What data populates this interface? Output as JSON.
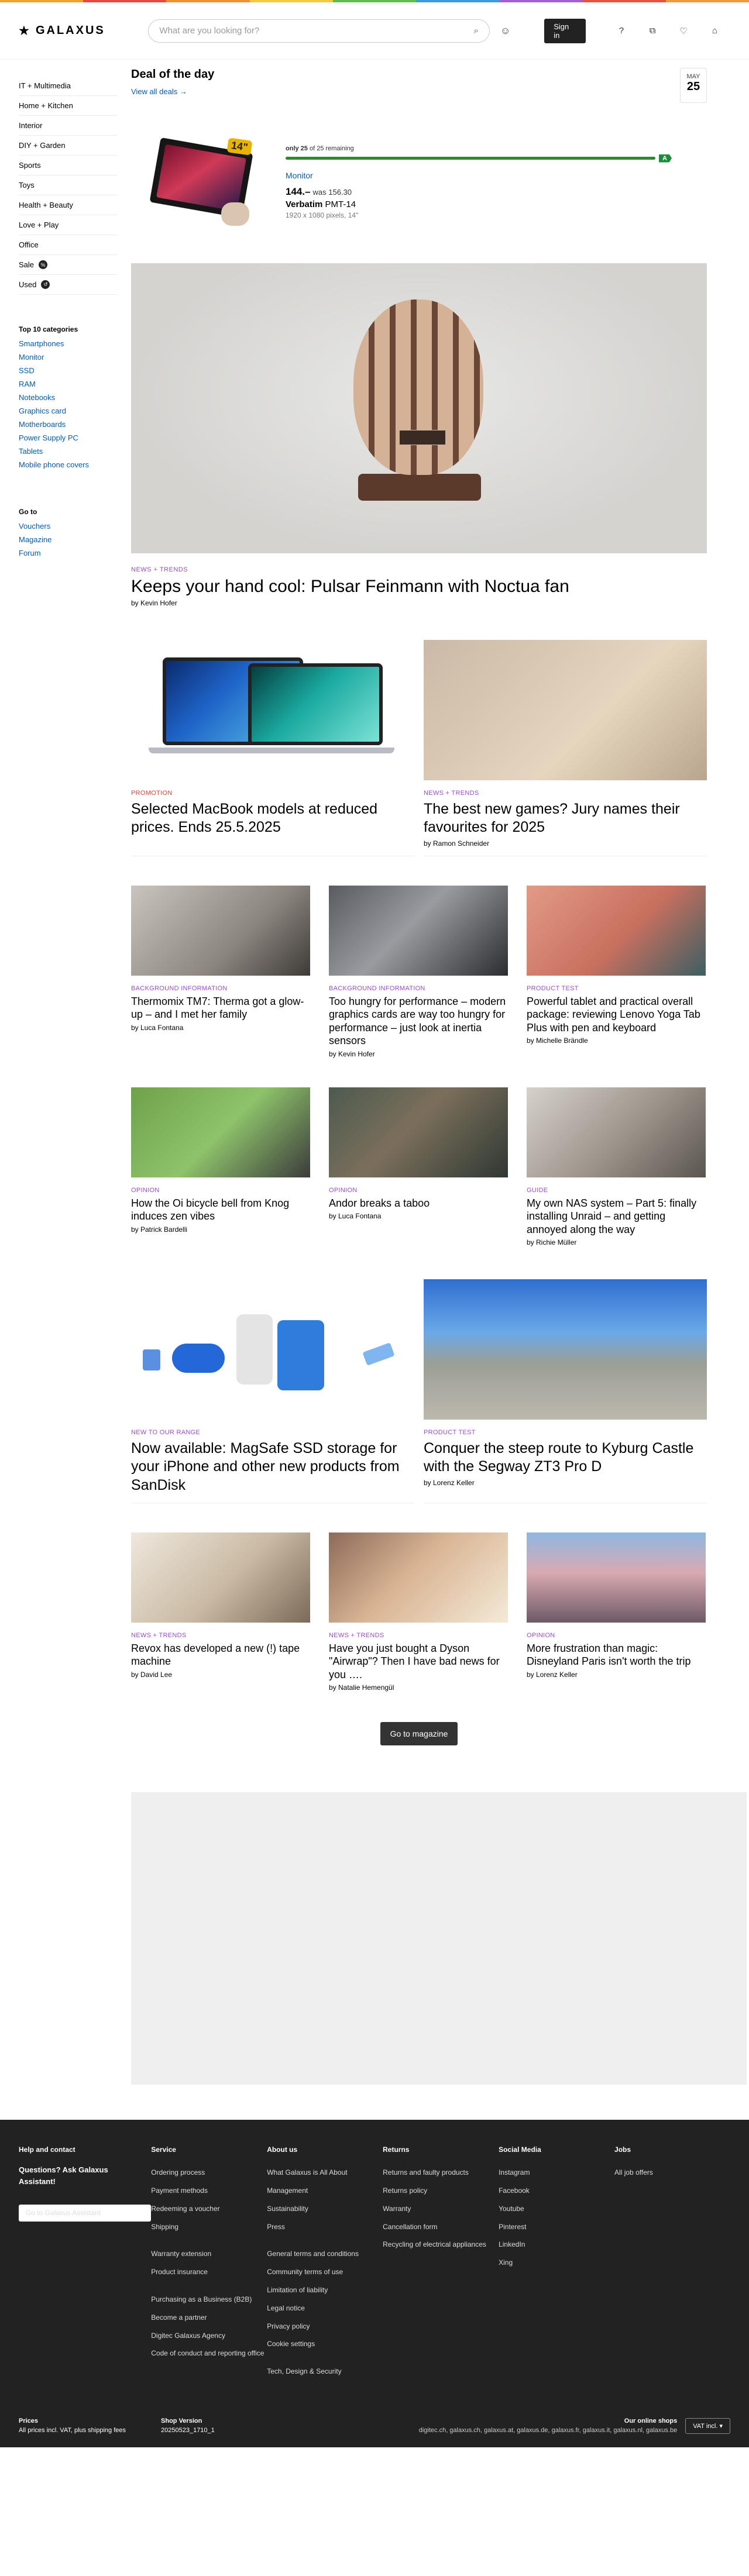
{
  "brand": {
    "name": "GALAXUS",
    "colors": [
      "#f4a32a",
      "#e9483e",
      "#f0902e",
      "#f6c83c",
      "#5cbf4d",
      "#3b9be0",
      "#a55fd6",
      "#e8513d",
      "#f19a3b"
    ]
  },
  "search": {
    "placeholder": "What are you looking for?"
  },
  "header": {
    "signin": "Sign in",
    "icons": [
      "person-circle-icon",
      "compare-icon",
      "heart-icon",
      "cart-icon"
    ]
  },
  "sidebar": {
    "items": [
      {
        "label": "IT + Multimedia"
      },
      {
        "label": "Home + Kitchen"
      },
      {
        "label": "Interior"
      },
      {
        "label": "DIY + Garden"
      },
      {
        "label": "Sports"
      },
      {
        "label": "Toys"
      },
      {
        "label": "Health + Beauty"
      },
      {
        "label": "Love + Play"
      },
      {
        "label": "Office"
      },
      {
        "label": "Sale",
        "badge": "%"
      },
      {
        "label": "Used",
        "badge": "↺"
      }
    ],
    "top_heading": "Top 10 categories",
    "top": [
      "Smartphones",
      "Monitor",
      "SSD",
      "RAM",
      "Notebooks",
      "Graphics card",
      "Motherboards",
      "Power Supply PC",
      "Tablets",
      "Mobile phone covers"
    ],
    "goto_heading": "Go to",
    "goto": [
      "Vouchers",
      "Magazine",
      "Forum"
    ]
  },
  "deal": {
    "title": "Deal of the day",
    "view_all": "View all deals",
    "month": "MAY",
    "day": "25",
    "remaining_count": "only 25",
    "remaining_rest": "of 25 remaining",
    "progress": 1.0,
    "energy": "A",
    "category": "Monitor",
    "price": "144.–",
    "was": "was 156.30",
    "brand": "Verbatim",
    "model": "PMT-14",
    "spec": "1920 x 1080 pixels, 14\"",
    "monitor_tag": "14\""
  },
  "hero": {
    "category": "News + Trends",
    "title": "Keeps your hand cool: Pulsar Feinmann with Noctua fan",
    "author": "by Kevin Hofer"
  },
  "row2a": [
    {
      "category": "Promotion",
      "title": "Selected MacBook models at reduced prices. Ends 25.5.2025",
      "author": ""
    },
    {
      "category": "News + Trends",
      "title": "The best new games? Jury names their favourites for 2025",
      "author": "by Ramon Schneider"
    }
  ],
  "row3a": [
    {
      "category": "Background information",
      "title": "Thermomix TM7: Therma got a glow-up – and I met her family",
      "author": "by Luca Fontana"
    },
    {
      "category": "Background information",
      "title": "Too hungry for performance – modern graphics cards are way too hungry for performance – just look at inertia sensors",
      "author": "by Kevin Hofer"
    },
    {
      "category": "Product test",
      "title": "Powerful tablet and practical overall package: reviewing Lenovo Yoga Tab Plus with pen and keyboard",
      "author": "by Michelle Brändle"
    }
  ],
  "row3b": [
    {
      "category": "Opinion",
      "title": "How the Oi bicycle bell from Knog induces zen vibes",
      "author": "by Patrick Bardelli"
    },
    {
      "category": "Opinion",
      "title": "Andor breaks a taboo",
      "author": "by Luca Fontana"
    },
    {
      "category": "Guide",
      "title": "My own NAS system – Part 5: finally installing Unraid – and getting annoyed along the way",
      "author": "by Richie Müller"
    }
  ],
  "row2b": [
    {
      "category": "New to our range",
      "title": "Now available: MagSafe SSD storage for your iPhone and other new products from SanDisk",
      "author": ""
    },
    {
      "category": "Product test",
      "title": "Conquer the steep route to Kyburg Castle with the Segway ZT3 Pro D",
      "author": "by Lorenz Keller"
    }
  ],
  "row3c": [
    {
      "category": "News + Trends",
      "title": "Revox has developed a new (!) tape machine",
      "author": "by David Lee"
    },
    {
      "category": "News + Trends",
      "title": "Have you just bought a Dyson \"Airwrap\"? Then I have bad news for you ….",
      "author": "by Natalie Hemengül"
    },
    {
      "category": "Opinion",
      "title": "More frustration than magic: Disneyland Paris isn't worth the trip",
      "author": "by Lorenz Keller"
    }
  ],
  "goto_magazine": "Go to magazine",
  "footer": {
    "help": {
      "heading": "Help and contact",
      "text": "Questions? Ask Galaxus Assistant!",
      "button": "Go to Galaxus Assistant"
    },
    "service": {
      "heading": "Service",
      "a": [
        "Ordering process",
        "Payment methods",
        "Redeeming a voucher",
        "Shipping"
      ],
      "b": [
        "Warranty extension",
        "Product insurance"
      ],
      "c": [
        "Purchasing as a Business (B2B)",
        "Become a partner",
        "Digitec Galaxus Agency",
        "Code of conduct and reporting office"
      ]
    },
    "about": {
      "heading": "About us",
      "a": [
        "What Galaxus is All About",
        "Management",
        "Sustainability",
        "Press"
      ],
      "b": [
        "General terms and conditions",
        "Community terms of use",
        "Limitation of liability",
        "Legal notice",
        "Privacy policy",
        "Cookie settings"
      ],
      "c": [
        "Tech, Design & Security"
      ]
    },
    "returns": {
      "heading": "Returns",
      "a": [
        "Returns and faulty products",
        "Returns policy",
        "Warranty",
        "Cancellation form",
        "Recycling of electrical appliances"
      ]
    },
    "social": {
      "heading": "Social Media",
      "a": [
        "Instagram",
        "Facebook",
        "Youtube",
        "Pinterest",
        "LinkedIn",
        "Xing"
      ]
    },
    "jobs": {
      "heading": "Jobs",
      "a": [
        "All job offers"
      ]
    },
    "prices_heading": "Prices",
    "prices_text": "All prices incl. VAT, plus shipping fees",
    "version_heading": "Shop Version",
    "version": "20250523_1710_1",
    "shops_heading": "Our online shops",
    "shops": "digitec.ch, galaxus.ch, galaxus.at, galaxus.de, galaxus.fr, galaxus.it, galaxus.nl, galaxus.be",
    "vat": "VAT incl."
  }
}
